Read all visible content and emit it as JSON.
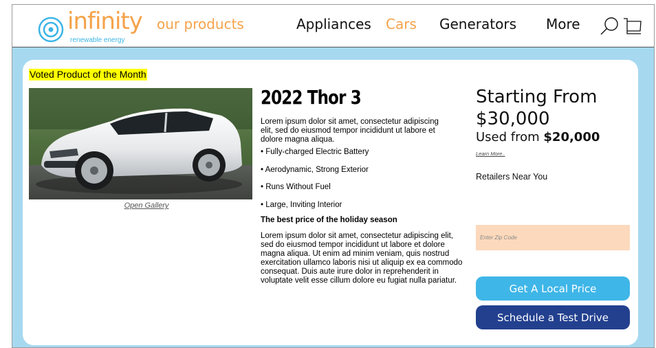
{
  "header": {
    "logo_word": "infinity",
    "logo_tagline": "renewable energy",
    "our_products": "our products",
    "nav": [
      {
        "label": "Appliances",
        "active": false
      },
      {
        "label": "Cars",
        "active": true
      },
      {
        "label": "Generators",
        "active": false
      },
      {
        "label": "More",
        "active": false
      }
    ],
    "icons": [
      "search-icon",
      "cart-icon"
    ]
  },
  "colors": {
    "accent_orange": "#f5a24a",
    "accent_blue": "#3fb6e8",
    "navy": "#23408f",
    "page_bg": "#a6d9f0",
    "highlight": "#ffff00",
    "zip_bg": "#fcd9bc"
  },
  "product": {
    "badge": "Voted Product of the Month",
    "gallery_link": "Open Gallery",
    "title": "2022 Thor 3",
    "intro": "Lorem ipsum dolor sit amet, consectetur adipiscing elit, sed do eiusmod tempor incididunt ut labore et dolore magna aliqua.",
    "features": [
      "• Fully-charged Electric Battery",
      "• Aerodynamic, Strong Exterior",
      "• Runs Without Fuel",
      "• Large, Inviting Interior"
    ],
    "holiday": "The best price of the holiday season",
    "body": "Lorem ipsum dolor sit amet, consectetur adipiscing elit, sed do eiusmod tempor incididunt ut labore et dolore magna aliqua. Ut enim ad minim veniam, quis nostrud exercitation ullamco laboris nisi ut aliquip ex ea commodo consequat. Duis aute irure dolor in reprehenderit in voluptate velit esse cillum dolore eu fugiat nulla pariatur."
  },
  "pricing": {
    "starting_label": "Starting From",
    "starting_price": "$30,000",
    "used_label": "Used from ",
    "used_price": "$20,000",
    "learn_more": "Learn More..",
    "retailers": "Retailers Near You",
    "zip_placeholder": "Enter Zip Code",
    "zip_value": "",
    "local_price_button": "Get A Local Price",
    "test_drive_button": "Schedule a Test Drive"
  }
}
